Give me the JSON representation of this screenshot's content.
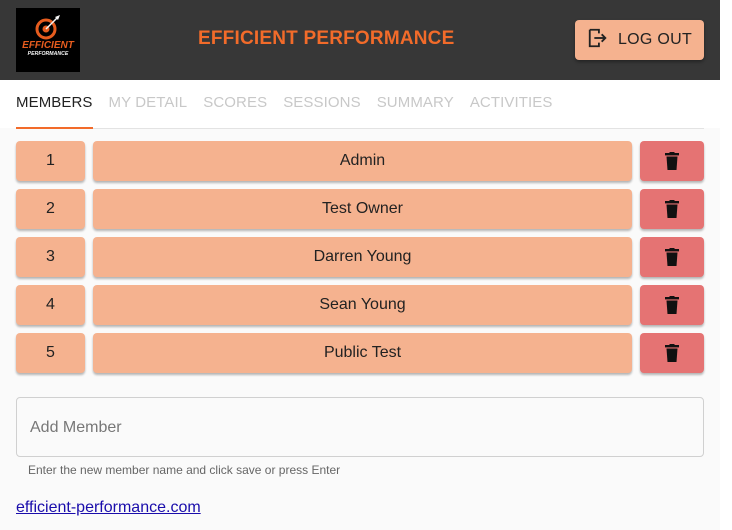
{
  "header": {
    "title": "EFFICIENT PERFORMANCE",
    "logo_text_top": "EFFICIENT",
    "logo_text_bottom": "PERFORMANCE",
    "logout_label": "LOG OUT"
  },
  "tabs": [
    {
      "label": "MEMBERS",
      "active": true
    },
    {
      "label": "MY DETAIL",
      "active": false
    },
    {
      "label": "SCORES",
      "active": false
    },
    {
      "label": "SESSIONS",
      "active": false
    },
    {
      "label": "SUMMARY",
      "active": false
    },
    {
      "label": "ACTIVITIES",
      "active": false
    }
  ],
  "members": [
    {
      "index": "1",
      "name": "Admin"
    },
    {
      "index": "2",
      "name": "Test Owner"
    },
    {
      "index": "3",
      "name": "Darren Young"
    },
    {
      "index": "4",
      "name": "Sean Young"
    },
    {
      "index": "5",
      "name": "Public Test"
    }
  ],
  "add_member": {
    "placeholder": "Add Member",
    "value": "",
    "helper": "Enter the new member name and click save or press Enter"
  },
  "footer": {
    "link_text": "efficient-performance.com"
  },
  "icons": {
    "delete": "trash-icon",
    "logout": "logout-icon",
    "logo": "dartboard-logo-icon"
  },
  "colors": {
    "header_bg": "#373737",
    "accent": "#f26b2a",
    "button_bg": "#f5b28f",
    "delete_bg": "#e57373"
  }
}
